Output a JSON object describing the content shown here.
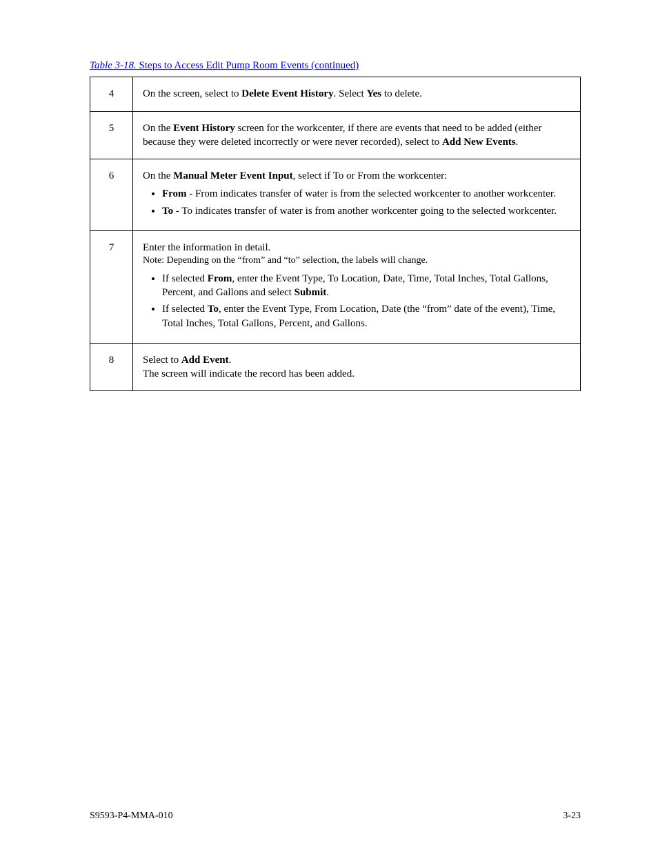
{
  "title": {
    "prefix": "Table 3-18.",
    "text": " Steps to Access Edit Pump Room Events (continued)"
  },
  "rows": [
    {
      "step": "4",
      "html": "On the screen, select to <b>Delete Event History</b>. Select <b>Yes</b> to delete."
    },
    {
      "step": "5",
      "html": "On the <b>Event History</b> screen for the workcenter, if there are events that need to be added (either because they were deleted incorrectly or were never recorded), select to <b>Add New Events</b>."
    },
    {
      "step": "6",
      "html": "On the <b>Manual Meter Event Input</b>, select if To or From the workcenter:<ul class=\"inner\"><li><b>From</b> - From indicates transfer of water is from the selected workcenter to another workcenter.</li><li><b>To</b> - To indicates transfer of water is from another workcenter going to the selected workcenter.</li></ul>"
    },
    {
      "step": "7",
      "html": "<div>Enter the information in detail.</div><div class=\"small-note\">Note: Depending on the “from” and “to” selection, the labels will change.</div><ul class=\"inner\"><li>If selected <b>From</b>, enter the Event Type, To Location, Date, Time, Total Inches, Total Gallons, Percent, and Gallons and select <b>Submit</b>.</li><li>If selected <b>To</b>, enter the Event Type, From Location, Date (the “from” date of the event), Time, Total Inches, Total Gallons, Percent, and Gallons.</li></ul>"
    },
    {
      "step": "8",
      "html": "Select to <b>Add Event</b>.<div>The screen will indicate the record has been added.</div>"
    }
  ],
  "footer": {
    "left": "S9593-P4-MMA-010",
    "right": "3-23"
  }
}
